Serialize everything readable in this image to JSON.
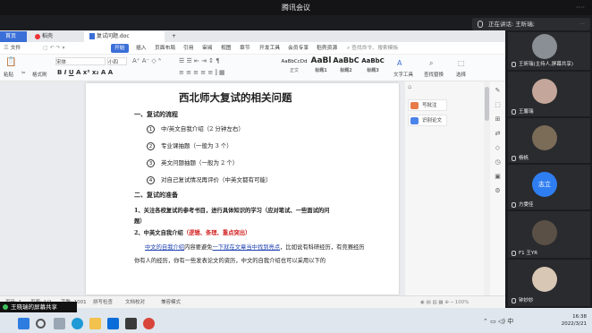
{
  "window": {
    "title": "腾讯会议",
    "title_dots": "····"
  },
  "speaker_bar": {
    "label": "正在讲话: 王昕瑞;",
    "dots": "···"
  },
  "wps": {
    "tabs": {
      "home": "首页",
      "wps": "稻壳",
      "doc": "复试问题.doc",
      "add": "+"
    },
    "menu": [
      "三 文件",
      "插入",
      "页面布局",
      "引用",
      "审阅",
      "视图",
      "章节",
      "开发工具",
      "会员专享",
      "稻壳资源",
      "查找命令、搜索模板"
    ],
    "menu_start": "开始",
    "ribbon": {
      "paste": "粘贴",
      "format_painter": "格式刷",
      "font": "宋体",
      "size": "小四",
      "styles": [
        {
          "sample": "AaBbCcDd",
          "label": "正文"
        },
        {
          "sample": "AaBl",
          "label": "标题1"
        },
        {
          "sample": "AaBbC",
          "label": "标题2"
        },
        {
          "sample": "AaBbC",
          "label": "标题3"
        }
      ],
      "text_tools": "文字工具",
      "find_replace": "查找替换",
      "select": "选择"
    },
    "side_panel": {
      "btn1": "写批注",
      "btn2": "识别论文"
    },
    "status": {
      "page": "页码: 1",
      "pages": "页面: 1/2",
      "words": "字数: 1001",
      "spell": "拼写检查",
      "doc_check": "文档校对",
      "compat": "兼容模式"
    }
  },
  "document": {
    "title": "西北师大复试的相关问题",
    "s1": "一、复试的流程",
    "items": [
      {
        "n": "1",
        "text": "中/英文自我介绍（2 分钟左右）"
      },
      {
        "n": "2",
        "text": "专业课抽题（一般为 3 个）"
      },
      {
        "n": "3",
        "text": "英文问题抽题（一般为 2 个）"
      },
      {
        "n": "4",
        "text": "对自己复试情况再评价（中英文都有可能）"
      }
    ],
    "s2": "二、复试的准备",
    "p1": "1、关注各校复试的参考书目，进行具体知识的学习（应对笔试、一些面试的问",
    "p1b": "题）",
    "p2_prefix": "2、中英文自我介绍",
    "p2_red": "（逻辑、条理、重点突出）",
    "p3_blue": "中文的自我介绍",
    "p3_mid": "内容要避免",
    "p3_blue2": "一下就在文章当中找到亮点",
    "p3_rest": "，比如说有科研经历，有竞赛经历",
    "p4": "你有人的经历，你有一些发表论文的资历，中文的自我介绍也可以采用以下的"
  },
  "share": "王晓瑞的屏幕共享",
  "clock": {
    "time": "16:38",
    "date": "2022/3/21"
  },
  "participants": [
    {
      "name": "王昕瑞(主持人,屏幕共享)"
    },
    {
      "name": "王馨瑞"
    },
    {
      "name": "杨帆"
    },
    {
      "name": "志立",
      "initial": "志立"
    },
    {
      "name": "方雯佳"
    },
    {
      "name": "F1 王YR"
    },
    {
      "name": "钟妙妙"
    }
  ],
  "colors": {
    "accent": "#3b6fd8",
    "taskbar": "#dfe6ee",
    "red": "#d32020"
  }
}
